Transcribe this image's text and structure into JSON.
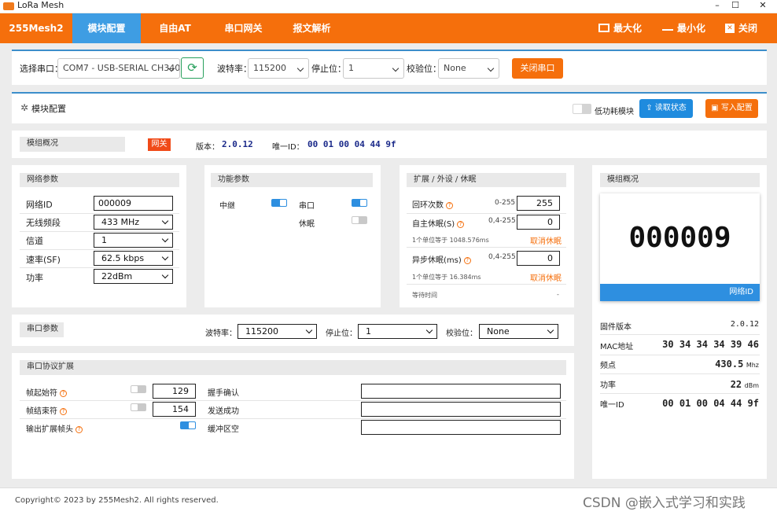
{
  "window": {
    "title": "LoRa Mesh",
    "min": "–",
    "max": "☐",
    "close": "✕"
  },
  "nav": {
    "brand": "255Mesh2",
    "tabs": [
      "模块配置",
      "自由AT",
      "串口网关",
      "报文解析"
    ],
    "maximize": "最大化",
    "minimize": "最小化",
    "close": "关闭"
  },
  "serial": {
    "port_label": "选择串口：",
    "port_value": "COM7 - USB-SERIAL CH340",
    "baud_label": "波特率：",
    "baud_value": "115200",
    "stop_label": "停止位：",
    "stop_value": "1",
    "parity_label": "校验位：",
    "parity_value": "None",
    "close_btn": "关闭串口"
  },
  "config": {
    "title": "模块配置",
    "low_power": "低功耗模块",
    "read_btn": "读取状态",
    "write_btn": "写入配置"
  },
  "overview": {
    "title": "模组概况",
    "badge": "网关",
    "version_label": "版本：",
    "version": "2.0.12",
    "uid_label": "唯一ID：",
    "uid": "00 01 00 04 44 9f"
  },
  "network": {
    "title": "网络参数",
    "rows": [
      {
        "label": "网络ID",
        "value": "000009"
      },
      {
        "label": "无线频段",
        "value": "433 MHz"
      },
      {
        "label": "信道",
        "value": "1"
      },
      {
        "label": "速率(SF)",
        "value": "62.5 kbps"
      },
      {
        "label": "功率",
        "value": "22dBm"
      }
    ]
  },
  "func": {
    "title": "功能参数",
    "relay": "中继",
    "serial": "串口",
    "sleep": "休眠"
  },
  "ext": {
    "title": "扩展 / 外设 / 休眠",
    "loop_label": "回环次数",
    "loop_range": "0-255",
    "loop_value": "255",
    "auto_label": "自主休眠(S)",
    "auto_range": "0,4-255",
    "auto_value": "0",
    "auto_note": "1个单位等于 1048.576ms",
    "cancel1": "取消休眠",
    "async_label": "异步休眠(ms)",
    "async_range": "0,4-255",
    "async_value": "0",
    "async_note": "1个单位等于 16.384ms",
    "cancel2": "取消休眠",
    "wait_label": "等待时间",
    "wait_value": "-"
  },
  "uart": {
    "title": "串口参数",
    "baud_label": "波特率：",
    "baud_value": "115200",
    "stop_label": "停止位：",
    "stop_value": "1",
    "parity_label": "校验位：",
    "parity_value": "None"
  },
  "proto": {
    "title": "串口协议扩展",
    "start_label": "帧起始符",
    "start_value": "129",
    "end_label": "帧结束符",
    "end_value": "154",
    "out_label": "输出扩展帧头",
    "hs_label": "握手确认",
    "send_label": "发送成功",
    "buf_label": "缓冲区空"
  },
  "side": {
    "title": "模组概况",
    "net_id": "000009",
    "net_label": "网络ID",
    "rows": [
      {
        "label": "固件版本",
        "value": "2.0.12",
        "unit": ""
      },
      {
        "label": "MAC地址",
        "value": "30 34 34 34 39 46",
        "unit": ""
      },
      {
        "label": "频点",
        "value": "430.5",
        "unit": "Mhz"
      },
      {
        "label": "功率",
        "value": "22",
        "unit": "dBm"
      },
      {
        "label": "唯一ID",
        "value": "00 01 00 04 44 9f",
        "unit": ""
      }
    ]
  },
  "footer": {
    "copyright": "Copyright© 2023 by 255Mesh2. All rights reserved.",
    "watermark": "CSDN @嵌入式学习和实践"
  }
}
